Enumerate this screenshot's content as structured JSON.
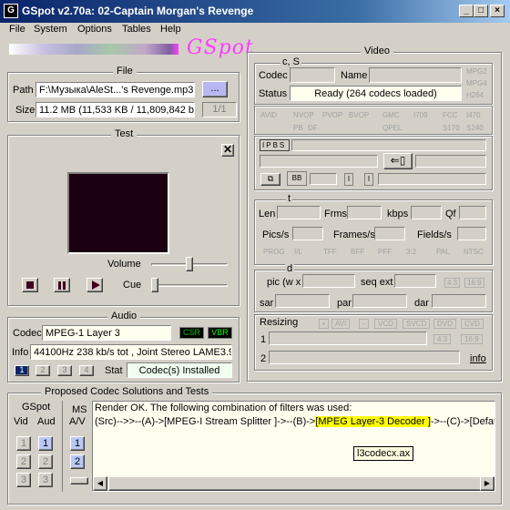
{
  "window": {
    "title": "GSpot v2.70a: 02-Captain Morgan's Revenge",
    "icon_text": "G",
    "minimize": "_",
    "maximize": "□",
    "close": "×"
  },
  "menu": [
    "File",
    "System",
    "Options",
    "Tables",
    "Help"
  ],
  "logo_text": "GSpot",
  "file": {
    "title": "File",
    "path_label": "Path",
    "path_value": "F:\\Музыка\\AleSt...'s Revenge.mp3",
    "browse_label": "...",
    "size_label": "Size",
    "size_value": "11.2 MB (11,533 KB / 11,809,842 b",
    "part": "1/1"
  },
  "test": {
    "title": "Test",
    "volume_label": "Volume",
    "cue_label": "Cue"
  },
  "audio": {
    "title": "Audio",
    "codec_label": "Codec",
    "codec_value": "MPEG-1 Layer 3",
    "csr": "CSR",
    "vbr": "VBR",
    "info_label": "Info",
    "info_value": "44100Hz  238 kb/s tot , Joint Stereo LAME3.9",
    "tracks": [
      "1",
      "2",
      "3",
      "4"
    ],
    "stat_label": "Stat",
    "stat_value": "Codec(s) Installed"
  },
  "video": {
    "title": "Video",
    "cs_label": "c, S",
    "codec_label": "Codec",
    "name_label": "Name",
    "status_label": "Status",
    "status_value": "Ready (264 codecs loaded)",
    "mpeg_flags": [
      "MPG2",
      "MPG4",
      "H264"
    ],
    "flags_row1": [
      "AVID",
      "NVOP",
      "PVOP",
      "BVOP",
      "GMC",
      "I709",
      "FCC",
      "I470"
    ],
    "flags_row2": [
      "PB",
      "DF",
      "QPEL",
      "S170",
      "S240"
    ],
    "ipbs": [
      "I",
      "P",
      "B",
      "S"
    ],
    "t_label": "t",
    "len_label": "Len",
    "frms_label": "Frms",
    "kbps_label": "kbps",
    "qf_label": "Qf",
    "pics_label": "Pics/s",
    "frames_label": "Frames/s",
    "fields_label": "Fields/s",
    "flags_row3": [
      "PROG",
      "I/L",
      "TFF",
      "BFF",
      "PFF",
      "3:2",
      "PAL",
      "NTSC"
    ],
    "d_label": "d",
    "pic_label": "pic (w x",
    "seqext_label": "seq ext",
    "ar43": "4:3",
    "ar169": "16:9",
    "sar_label": "sar",
    "par_label": "par",
    "dar_label": "dar",
    "resizing_label": "Resizing",
    "resize_btns": [
      "AVI",
      "VCD",
      "SVCD",
      "DVD",
      "CVD"
    ],
    "row1": "1",
    "row2": "2",
    "ar43b": "4:3",
    "ar169b": "16:9",
    "info_link": "info"
  },
  "proposed": {
    "title": "Proposed Codec Solutions and Tests",
    "gspot_label": "GSpot",
    "vid_label": "Vid",
    "aud_label": "Aud",
    "ms_label": "MS",
    "av_label": "A/V",
    "vid_btns": [
      "1",
      "2",
      "3"
    ],
    "aud_btns": [
      "1",
      "2",
      "3"
    ],
    "ms_btns": [
      "1",
      "2"
    ],
    "render_ok": "Render OK.  The following combination of filters was used:",
    "chain_pre": "(Src)-->>--(A)->[MPEG-I Stream Splitter ]->--(B)->",
    "chain_hl": "[MPEG Layer-3 Decoder ]",
    "chain_post": "->--(C)->[Default Dir",
    "tooltip": "l3codecx.ax"
  },
  "colors": {
    "titlebar_start": "#0a246a",
    "titlebar_end": "#a6caf0",
    "highlight": "#ffff00",
    "logo": "#ff3cff"
  }
}
